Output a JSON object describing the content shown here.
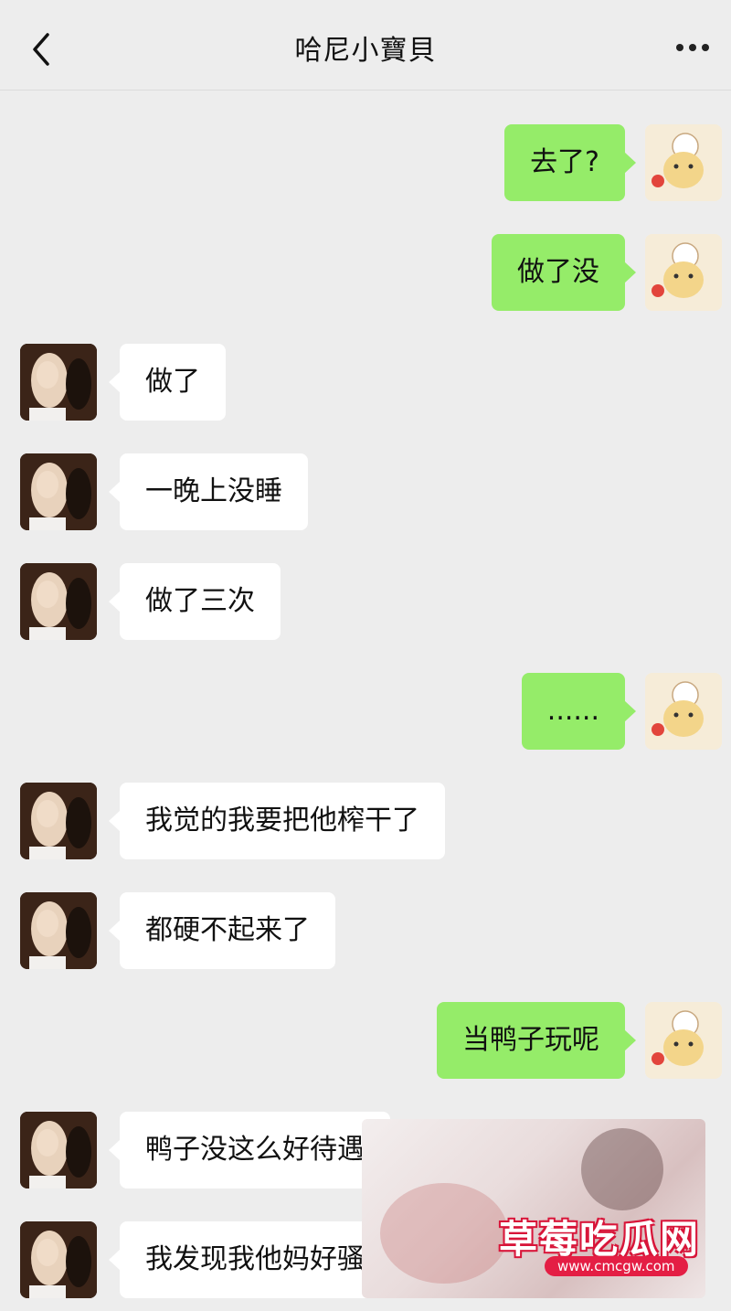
{
  "header": {
    "title": "哈尼小寶貝"
  },
  "icons": {
    "back": "back-chevron-icon",
    "more": "more-dots-icon"
  },
  "messages": [
    {
      "side": "self",
      "text": "去了?"
    },
    {
      "side": "self",
      "text": "做了没"
    },
    {
      "side": "other",
      "text": "做了"
    },
    {
      "side": "other",
      "text": "一晚上没睡"
    },
    {
      "side": "other",
      "text": "做了三次"
    },
    {
      "side": "self",
      "text": "......"
    },
    {
      "side": "other",
      "text": "我觉的我要把他榨干了"
    },
    {
      "side": "other",
      "text": "都硬不起来了"
    },
    {
      "side": "self",
      "text": "当鸭子玩呢"
    },
    {
      "side": "other",
      "text": "鸭子没这么好待遇"
    },
    {
      "side": "other",
      "text": "我发现我他妈好骚"
    }
  ],
  "watermark": {
    "brand": "草莓吃瓜网",
    "url": "www.cmcgw.com"
  },
  "colors": {
    "self_bubble": "#95ec69",
    "other_bubble": "#ffffff",
    "background": "#ededed"
  }
}
